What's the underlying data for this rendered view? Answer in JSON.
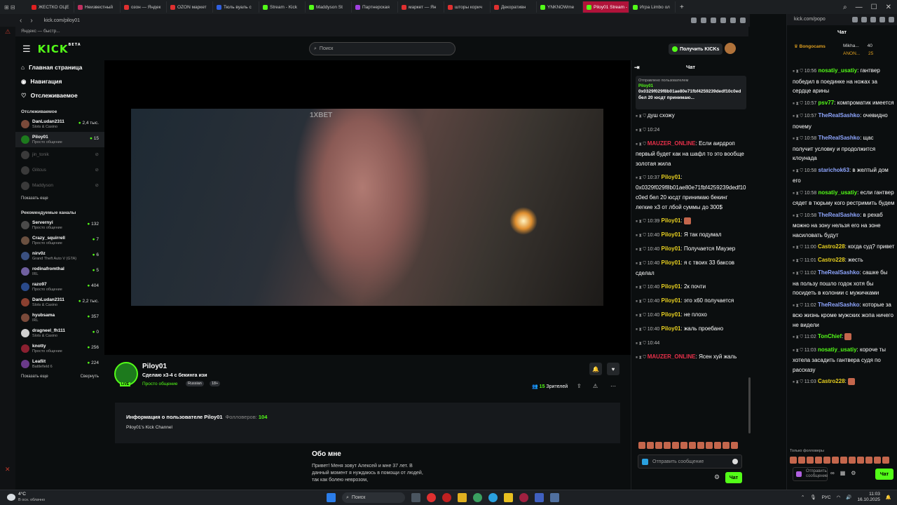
{
  "browser": {
    "tabs": [
      {
        "label": "ЖЕСТКО ОЦЕ",
        "color": "#e02020"
      },
      {
        "label": "Неизвестный",
        "color": "#c03060"
      },
      {
        "label": "озон — Яндек",
        "color": "#e03030"
      },
      {
        "label": "OZON маркет",
        "color": "#e03030"
      },
      {
        "label": "Тюль вуаль с",
        "color": "#3060e0"
      },
      {
        "label": "Stream - Kick",
        "color": "#53fc18"
      },
      {
        "label": "Maddyson St",
        "color": "#53fc18"
      },
      {
        "label": "Партнерская",
        "color": "#a040e0"
      },
      {
        "label": "маркет — Ян",
        "color": "#e03030"
      },
      {
        "label": "шторы корич",
        "color": "#e03030"
      },
      {
        "label": "Декоративн",
        "color": "#e03030"
      },
      {
        "label": "YNKNOWme",
        "color": "#53fc18"
      },
      {
        "label": "Piloy01 Stream - Watch L",
        "color": "#53fc18",
        "active": true
      },
      {
        "label": "Игра Limbo ол",
        "color": "#53fc18"
      }
    ],
    "url": "kick.com/piloy01",
    "bookmark": "Яндекс — быстр...",
    "popup_url": "kick.com/popo"
  },
  "header": {
    "logo": "KICK",
    "logo_sup": "BETA",
    "search_placeholder": "Поиск",
    "get_kicks": "Получить KICKs"
  },
  "sidebar": {
    "nav": [
      {
        "label": "Главная страница",
        "icon": "home-icon",
        "glyph": "⌂"
      },
      {
        "label": "Навигация",
        "icon": "compass-icon",
        "glyph": "◉"
      },
      {
        "label": "Отслеживаемое",
        "icon": "heart-icon",
        "glyph": "♡"
      }
    ],
    "following_title": "Отслеживаемое",
    "following": [
      {
        "name": "DanLudan2311",
        "cat": "Slots & Casino",
        "viewers": "2,4 тыс.",
        "online": true
      },
      {
        "name": "Piloy01",
        "cat": "Просто общение",
        "viewers": "15",
        "online": true,
        "active": true
      },
      {
        "name": "jin_tonik",
        "cat": "",
        "viewers": "",
        "online": false
      },
      {
        "name": "Glitcus",
        "cat": "",
        "viewers": "",
        "online": false
      },
      {
        "name": "Maddyson",
        "cat": "",
        "viewers": "",
        "online": false
      }
    ],
    "show_more": "Показать еще",
    "recommended_title": "Рекомендуемые каналы",
    "recommended": [
      {
        "name": "Servernyi",
        "cat": "Просто общение",
        "viewers": "132"
      },
      {
        "name": "Crazy_squirrell",
        "cat": "Просто общение",
        "viewers": "7"
      },
      {
        "name": "nirv0z",
        "cat": "Grand Theft Auto V (GTA)",
        "viewers": "6"
      },
      {
        "name": "rodinafromthal",
        "cat": "IRL",
        "viewers": "5"
      },
      {
        "name": "razo97",
        "cat": "Просто общение",
        "viewers": "404"
      },
      {
        "name": "DanLudan2311",
        "cat": "Slots & Casino",
        "viewers": "2,2 тыс."
      },
      {
        "name": "hyubsama",
        "cat": "IRL",
        "viewers": "357"
      },
      {
        "name": "dragneel_fh111",
        "cat": "Slots & Casino",
        "viewers": "0"
      },
      {
        "name": "knotty",
        "cat": "Просто общение",
        "viewers": "256"
      },
      {
        "name": "Leafiit",
        "cat": "Battlefield 6",
        "viewers": "224"
      }
    ],
    "show_more2": "Показать еще",
    "collapse": "Свернуть"
  },
  "player": {
    "watermark": "1XBET"
  },
  "stream": {
    "name": "Piloy01",
    "title": "Сделаю х3-4 с бекинга изи",
    "category": "Просто общение",
    "tags": [
      "Russian",
      "18+"
    ],
    "live": "LIVE",
    "viewers_count": "15",
    "viewers_label": "Зрителей"
  },
  "user_info": {
    "title": "Информация о пользователе Piloy01",
    "followers_label": "Фолловеров:",
    "followers": "104",
    "desc": "Piloy01's Kick Channel"
  },
  "about": {
    "title": "Обо мне",
    "text": "Привет! Меня зовут Алексей и мне 37 лет. В данный момент я нуждаюсь в помощи от людей, так как болею неврозом,"
  },
  "chat": {
    "title": "Чат",
    "pinned_label": "Отправлено пользователем",
    "pinned_user": "Piloy01",
    "pinned_text": "0x0329f029f8b01ae80e71fbf4259239dedf10c0ed бел 20 юсдт принимаю...",
    "messages": [
      {
        "time": "",
        "user": "",
        "color": "#fff",
        "text": "душ схожу"
      },
      {
        "time": "10:24",
        "user": "",
        "color": "#fff",
        "text": ""
      },
      {
        "time": "",
        "user": "MAUZER_ONLINE",
        "color": "#e8304a",
        "text": "Если аирдроп первый будет как на шафл то это вообще золотая жила"
      },
      {
        "time": "10:37",
        "user": "Piloy01",
        "color": "#e8d020",
        "text": "0x0329f029f8b01ae80e71fbf4259239dedf10c0ed бел 20 юсдт принимаю бекинг легкие х3 от лбой суммы до 300$"
      },
      {
        "time": "10:39",
        "user": "Piloy01",
        "color": "#e8d020",
        "text": ""
      },
      {
        "time": "10:40",
        "user": "Piloy01",
        "color": "#e8d020",
        "text": "Я так подумал"
      },
      {
        "time": "10:40",
        "user": "Piloy01",
        "color": "#e8d020",
        "text": "Получается Маузер"
      },
      {
        "time": "10:40",
        "user": "Piloy01",
        "color": "#e8d020",
        "text": "я с твоих 33 баксов сделал"
      },
      {
        "time": "10:40",
        "user": "Piloy01",
        "color": "#e8d020",
        "text": "2к почти"
      },
      {
        "time": "10:40",
        "user": "Piloy01",
        "color": "#e8d020",
        "text": "это х60 получается"
      },
      {
        "time": "10:40",
        "user": "Piloy01",
        "color": "#e8d020",
        "text": "не плохо"
      },
      {
        "time": "10:40",
        "user": "Piloy01",
        "color": "#e8d020",
        "text": "жаль проебано"
      },
      {
        "time": "10:44",
        "user": "",
        "color": "#fff",
        "text": ""
      },
      {
        "time": "",
        "user": "MAUZER_ONLINE",
        "color": "#e8304a",
        "text": "Ясен хуй жаль"
      }
    ],
    "input_placeholder": "Отправить сообщение",
    "send": "Чат"
  },
  "popup": {
    "title": "Чат",
    "users": [
      {
        "name": "Bongocams",
        "extra": "Mikha...",
        "count": "40"
      },
      {
        "name": "",
        "extra": "ANON...",
        "count": "25"
      }
    ],
    "messages": [
      {
        "time": "10:56",
        "user": "nosatiy_usatiy",
        "color": "#53fc18",
        "text": "гантвер победил в поединке на ножах за сердце арины"
      },
      {
        "time": "10:57",
        "user": "psv77",
        "color": "#53fc18",
        "text": "компроматик имеется"
      },
      {
        "time": "10:57",
        "user": "TheRealSashko",
        "color": "#8fa6ff",
        "text": "очевидно почему"
      },
      {
        "time": "10:58",
        "user": "TheRealSashko",
        "color": "#8fa6ff",
        "text": "щас получит условку и продолжится клоунада"
      },
      {
        "time": "10:58",
        "user": "starichok63",
        "color": "#8fa6ff",
        "text": "в желтый дом его"
      },
      {
        "time": "10:58",
        "user": "nosatiy_usatiy",
        "color": "#53fc18",
        "text": "если гантвер сядет в тюрьму кого рестримить будем"
      },
      {
        "time": "10:58",
        "user": "TheRealSashko",
        "color": "#8fa6ff",
        "text": "в рехаб можно на зону нельзя его на зоне насиловать будут"
      },
      {
        "time": "11:00",
        "user": "Castro228",
        "color": "#e8d020",
        "text": "когда суд? привет"
      },
      {
        "time": "11:01",
        "user": "Castro228",
        "color": "#e8d020",
        "text": "жесть"
      },
      {
        "time": "11:02",
        "user": "TheRealSashko",
        "color": "#8fa6ff",
        "text": "сашке бы на пользу пошло годок хотя бы посидеть в колонии с мужичками"
      },
      {
        "time": "11:02",
        "user": "TheRealSashko",
        "color": "#8fa6ff",
        "text": "которые за всю жизнь кроме мужских жопа ничего не видели"
      },
      {
        "time": "11:02",
        "user": "TonChief",
        "color": "#53fc18",
        "text": ""
      },
      {
        "time": "11:03",
        "user": "nosatiy_usatiy",
        "color": "#53fc18",
        "text": "короче ты хотела засадить гантвера судя по рассказу"
      },
      {
        "time": "11:03",
        "user": "Castro228",
        "color": "#e8d020",
        "text": ""
      }
    ],
    "followers_only": "Только фолловеры",
    "input_placeholder": "Отправить сообщение",
    "send": "Чат"
  },
  "taskbar": {
    "temp": "4°C",
    "weather": "В осн. облачно",
    "search": "Поиск",
    "lang": "РУС",
    "time": "11:03",
    "date": "16.10.2025"
  }
}
